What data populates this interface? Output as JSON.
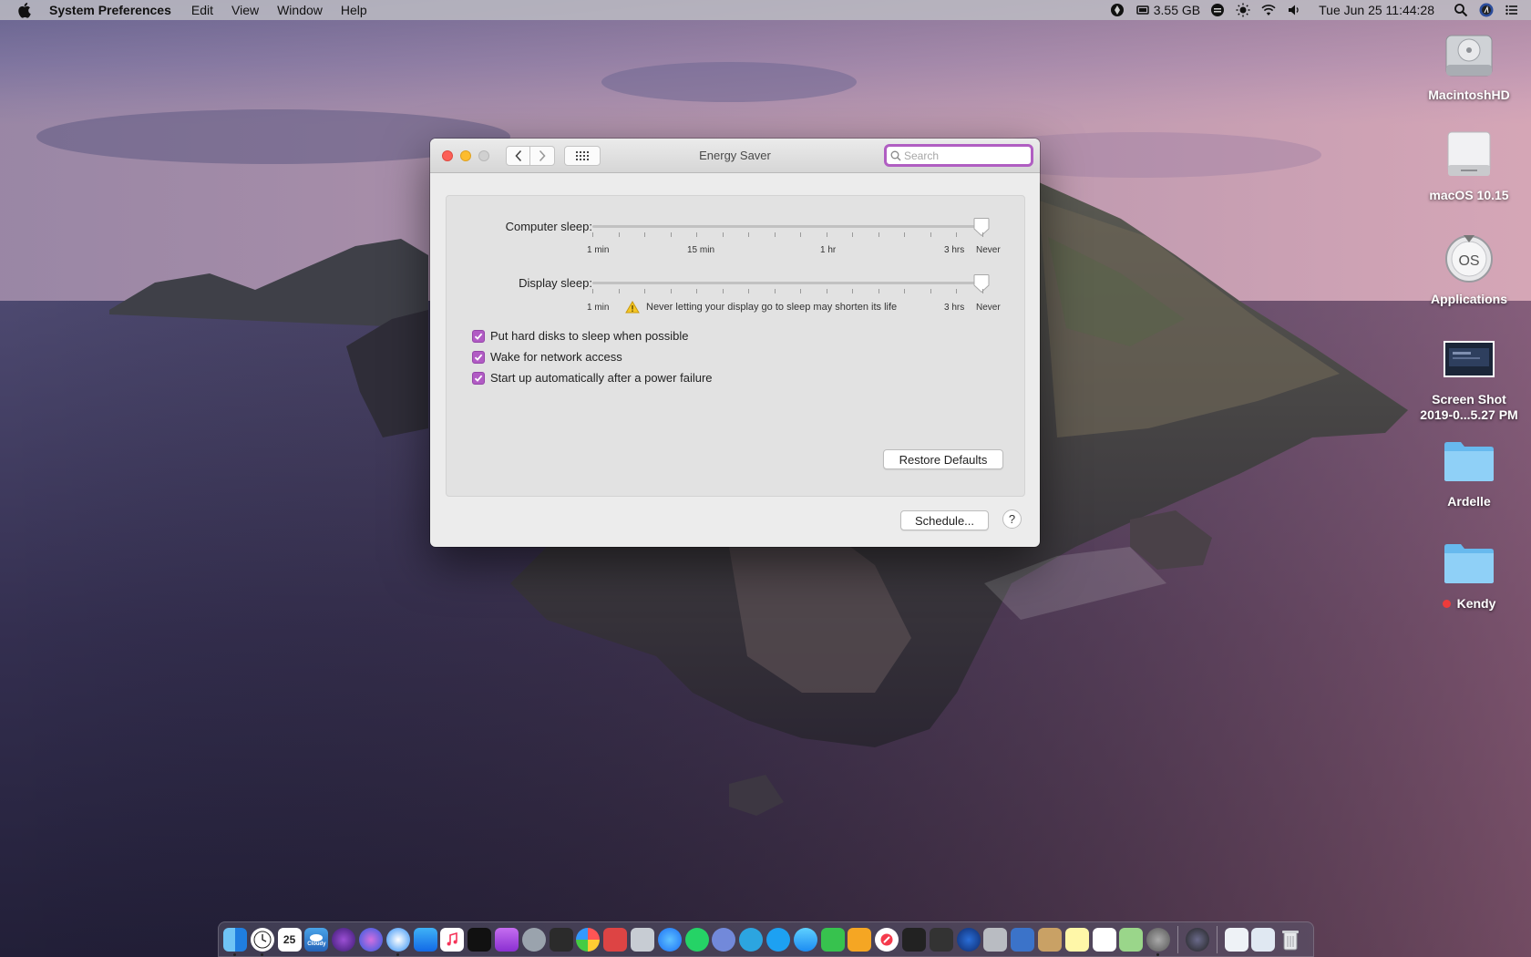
{
  "menubar": {
    "app_name": "System Preferences",
    "menus": [
      "Edit",
      "View",
      "Window",
      "Help"
    ],
    "memory": "3.55 GB",
    "clock": "Tue Jun 25  11:44:28"
  },
  "window": {
    "title": "Energy Saver",
    "search_placeholder": "Search",
    "computer_sleep": {
      "label": "Computer sleep:",
      "tick_labels": [
        "1 min",
        "15 min",
        "1 hr",
        "3 hrs",
        "Never"
      ],
      "value": "Never"
    },
    "display_sleep": {
      "label": "Display sleep:",
      "tick_labels": [
        "1 min",
        "3 hrs",
        "Never"
      ],
      "warning": "Never letting your display go to sleep may shorten its life",
      "value": "Never"
    },
    "checkboxes": [
      {
        "label": "Put hard disks to sleep when possible",
        "checked": true
      },
      {
        "label": "Wake for network access",
        "checked": true
      },
      {
        "label": "Start up automatically after a power failure",
        "checked": true
      }
    ],
    "restore_defaults": "Restore Defaults",
    "schedule": "Schedule...",
    "help": "?"
  },
  "desktop": {
    "icons": [
      {
        "label": "MacintoshHD",
        "icon": "hard-drive-icon"
      },
      {
        "label": "macOS 10.15",
        "icon": "external-drive-icon"
      },
      {
        "label": "Applications",
        "icon": "macos-installer-icon"
      },
      {
        "label_line1": "Screen Shot",
        "label_line2": "2019-0...5.27 PM",
        "icon": "screenshot-thumbnail"
      },
      {
        "label": "Ardelle",
        "icon": "folder-icon"
      },
      {
        "label": "Kendy",
        "icon": "folder-icon",
        "tag_color": "#ee3b3b"
      }
    ]
  },
  "dock": {
    "calendar_day": "25",
    "weather_label": "Cloudy"
  }
}
